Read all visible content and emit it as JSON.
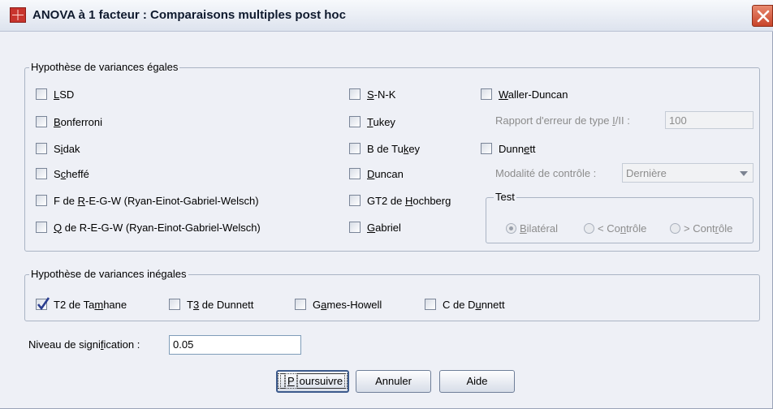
{
  "window": {
    "title": "ANOVA à 1 facteur : Comparaisons multiples post hoc"
  },
  "equal_variances": {
    "legend": "Hypothèse de variances égales",
    "col1": [
      {
        "pre": "",
        "u": "L",
        "post": "SD",
        "checked": false
      },
      {
        "pre": "",
        "u": "B",
        "post": "onferroni",
        "checked": false
      },
      {
        "pre": "S",
        "u": "i",
        "post": "dak",
        "checked": false
      },
      {
        "pre": "S",
        "u": "c",
        "post": "heffé",
        "checked": false
      },
      {
        "pre": "F de ",
        "u": "R",
        "post": "-E-G-W (Ryan-Einot-Gabriel-Welsch)",
        "checked": false
      },
      {
        "pre": "",
        "u": "Q",
        "post": " de R-E-G-W (Ryan-Einot-Gabriel-Welsch)",
        "checked": false
      }
    ],
    "col2": [
      {
        "pre": "",
        "u": "S",
        "post": "-N-K",
        "checked": false
      },
      {
        "pre": "",
        "u": "T",
        "post": "ukey",
        "checked": false
      },
      {
        "pre": "B de Tu",
        "u": "k",
        "post": "ey",
        "checked": false
      },
      {
        "pre": "",
        "u": "D",
        "post": "uncan",
        "checked": false
      },
      {
        "pre": "GT2 de ",
        "u": "H",
        "post": "ochberg",
        "checked": false
      },
      {
        "pre": "",
        "u": "G",
        "post": "abriel",
        "checked": false
      }
    ],
    "waller": {
      "pre": "",
      "u": "W",
      "post": "aller-Duncan",
      "checked": false
    },
    "error_ratio": {
      "pre": "Rapport d'erreur de type ",
      "u": "I",
      "post": "/II :",
      "value": "100"
    },
    "dunnett": {
      "pre": "Dunn",
      "u": "e",
      "post": "tt",
      "checked": false
    },
    "control": {
      "label": "Modalité de contrôle :",
      "value": "Dernière"
    },
    "test": {
      "legend": "Test",
      "options": [
        {
          "pre": "",
          "u": "B",
          "post": "ilatéral",
          "selected": true
        },
        {
          "pre": "< Co",
          "u": "n",
          "post": "trôle",
          "selected": false
        },
        {
          "pre": "> Cont",
          "u": "r",
          "post": "ôle",
          "selected": false
        }
      ]
    }
  },
  "unequal_variances": {
    "legend": "Hypothèse de variances inégales",
    "items": [
      {
        "pre": "T2 de Ta",
        "u": "m",
        "post": "hane",
        "checked": true
      },
      {
        "pre": "T",
        "u": "3",
        "post": " de Dunnett",
        "checked": false
      },
      {
        "pre": "G",
        "u": "a",
        "post": "mes-Howell",
        "checked": false
      },
      {
        "pre": "C de D",
        "u": "u",
        "post": "nnett",
        "checked": false
      }
    ]
  },
  "significance": {
    "pre": "Niveau de signi",
    "u": "f",
    "post": "ication :",
    "value": "0.05"
  },
  "buttons": {
    "continue": {
      "pre": "",
      "u": "P",
      "post": "oursuivre"
    },
    "cancel": "Annuler",
    "help": "Aide"
  }
}
